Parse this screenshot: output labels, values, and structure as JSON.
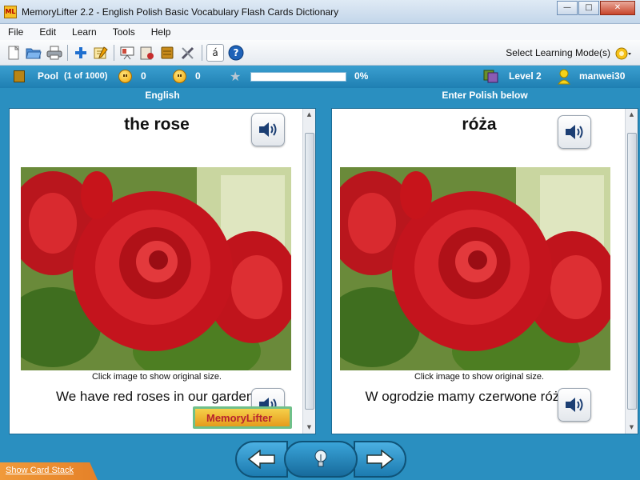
{
  "window": {
    "title": "MemoryLifter 2.2 - English Polish Basic Vocabulary Flash Cards Dictionary",
    "app_icon_text": "ML"
  },
  "menu": [
    "File",
    "Edit",
    "Learn",
    "Tools",
    "Help"
  ],
  "toolbar": {
    "select_mode_label": "Select Learning Mode(s)",
    "char_button": "á"
  },
  "status": {
    "pool_label": "Pool",
    "pool_count": "(1 of 1000)",
    "correct": "0",
    "wrong": "0",
    "progress_percent": "0%",
    "progress_fraction": 0,
    "level": "Level 2",
    "user": "manwei30"
  },
  "columns": {
    "left_header": "English",
    "right_header": "Enter Polish below"
  },
  "question": {
    "word": "the rose",
    "image_caption": "Click image to show original size.",
    "sentence": "We have red roses in our garden.",
    "logo_text": "MemoryLifter"
  },
  "answer": {
    "word": "róża",
    "image_caption": "Click image to show original size.",
    "sentence": "W ogrodzie mamy czerwone róże."
  },
  "bottom": {
    "show_card_stack": "Show Card Stack"
  },
  "colors": {
    "accent": "#2a8fc0",
    "rose_red": "#d11a1f"
  }
}
